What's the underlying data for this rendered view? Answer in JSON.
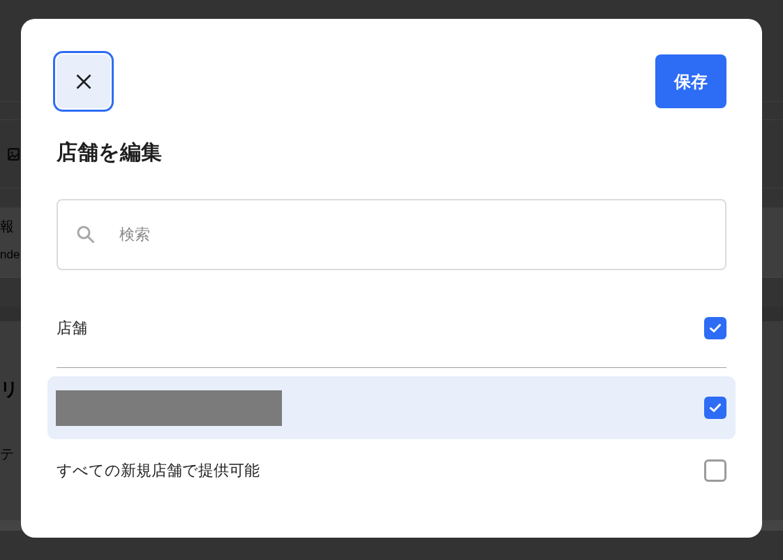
{
  "background_page": {
    "info_section": {
      "label": "報",
      "value": "nde"
    },
    "list_section": {
      "heading": "リ",
      "text": "テ"
    }
  },
  "dialog": {
    "close_button": {
      "focused": true
    },
    "save_button": {
      "label": "保存"
    },
    "title": "店舗を編集",
    "search": {
      "placeholder": "検索"
    },
    "select_all": {
      "label": "店舗",
      "checked": true
    },
    "stores": [
      {
        "kind": "redacted",
        "checked": true,
        "selected": true
      }
    ],
    "new_stores_option": {
      "label": "すべての新規店舗で提供可能",
      "checked": false
    }
  }
}
